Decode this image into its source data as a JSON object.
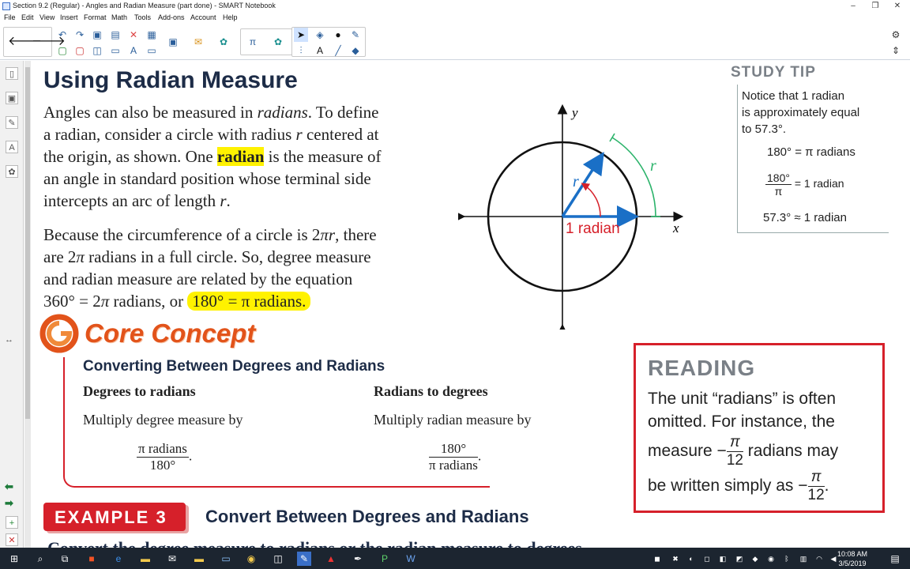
{
  "window": {
    "title": "Section 9.2 (Regular) - Angles and Radian Measure (part done) - SMART Notebook",
    "minimize": "–",
    "maximize": "❐",
    "close": "✕"
  },
  "menu": [
    "File",
    "Edit",
    "View",
    "Insert",
    "Format",
    "Math",
    "Tools",
    "Add-ons",
    "Account",
    "Help"
  ],
  "heading": "Using Radian Measure",
  "p1": {
    "l1a": "Angles can also be measured in ",
    "l1b": "radians",
    "l1c": ". To define",
    "l2a": "a radian, consider a circle with radius ",
    "l2b": "r",
    "l2c": " centered at",
    "l3a": "the origin, as shown. One ",
    "l3b": "radian",
    "l3c": " is the measure of",
    "l4": "an angle in standard position whose terminal side",
    "l5a": "intercepts an arc of length ",
    "l5b": "r",
    "l5c": "."
  },
  "p2": {
    "l1a": "Because the circumference of a circle is 2",
    "l1b": "π",
    "l1c": "r",
    "l1d": ", there",
    "l2a": "are 2",
    "l2b": "π",
    "l2c": " radians in a full circle. So, degree measure",
    "l3": "and radian measure are related by the equation",
    "l4a": "360° = 2",
    "l4b": "π",
    "l4c": " radians, or ",
    "l4d": "180° = π radians."
  },
  "diagram": {
    "y_label": "y",
    "x_label": "x",
    "r_label": "r",
    "arc_label": "r",
    "angle_label": "1 radian"
  },
  "study_tip": {
    "title": "STUDY TIP",
    "l1": "Notice that 1 radian",
    "l2": "is approximately equal",
    "l3": "to 57.3°.",
    "r1": "180° = π radians",
    "r2n": "180°",
    "r2d": "π",
    "r2e": "= 1 radian",
    "r3": "57.3° ≈ 1 radian"
  },
  "core": {
    "title": "Core Concept",
    "subtitle": "Converting Between Degrees and Radians",
    "col1_h": "Degrees to radians",
    "col1_p": "Multiply degree measure by",
    "col1_n": "π radians",
    "col1_d": "180°",
    "col2_h": "Radians to degrees",
    "col2_p": "Multiply radian measure by",
    "col2_n": "180°",
    "col2_d": "π radians",
    "dot": "."
  },
  "reading": {
    "title": "READING",
    "l1": "The unit “radians” is often",
    "l2": "omitted. For instance, the",
    "l3a": "measure −",
    "l3n": "π",
    "l3d": "12",
    "l3b": " radians may",
    "l4a": "be written simply as −",
    "l4n": "π",
    "l4d": "12",
    "l4b": "."
  },
  "example": {
    "badge": "EXAMPLE 3",
    "title": "Convert Between Degrees and Radians",
    "cut_text": "Convert the degree measure to radians or the radian measure to degrees."
  },
  "taskbar": {
    "time": "10:08 AM",
    "date": "3/5/2019"
  },
  "colors": {
    "accent_red": "#d6202a",
    "heading": "#1d2c47",
    "highlight": "#fff200",
    "arc_green": "#2bb36a",
    "ray_blue": "#1a6fc6"
  }
}
